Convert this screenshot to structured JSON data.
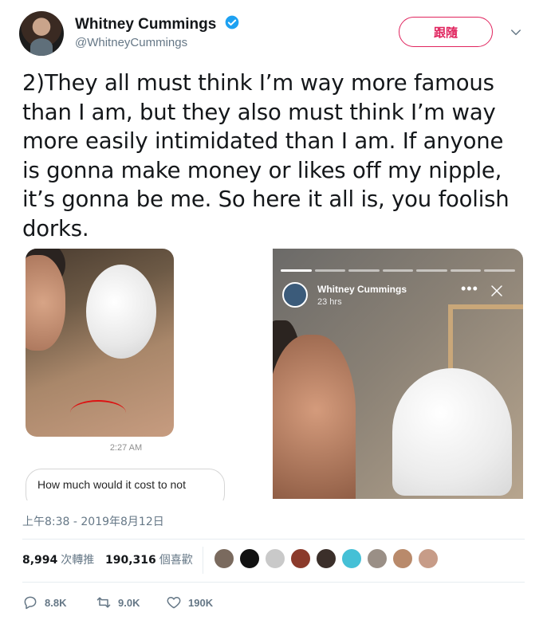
{
  "author": {
    "name": "Whitney Cummings",
    "handle": "@WhitneyCummings",
    "verified": true
  },
  "follow_button": {
    "label": "跟隨"
  },
  "tweet": {
    "lines": [
      "2)They all must think I’m way more famous",
      "than I am, but they also must think I’m way",
      "more easily intimidated than I am. If anyone",
      "is gonna make money or likes off my nipple,",
      "it’s gonna be me. So here it all is, you foolish",
      "dorks."
    ]
  },
  "media": {
    "left": {
      "message_time": "2:27 AM",
      "message_text": "How much would it cost to not"
    },
    "right": {
      "story_user": "Whitney Cummings",
      "story_time": "23 hrs",
      "story_progress_segments": 7,
      "story_current_segment": 1
    }
  },
  "timestamp": "上午8:38 - 2019年8月12日",
  "stats": {
    "retweets_count": "8,994",
    "retweets_label": "次轉推",
    "likes_count": "190,316",
    "likes_label": "個喜歡",
    "liker_avatar_colors": [
      "#7a6a5e",
      "#111111",
      "#c9c9c9",
      "#8b3a2b",
      "#3b2f2a",
      "#45c0d6",
      "#9a8f86",
      "#b98a6b",
      "#c79c88"
    ]
  },
  "actions": {
    "reply_count": "8.8K",
    "retweet_count": "9.0K",
    "like_count": "190K"
  },
  "colors": {
    "accent": "#e0245e",
    "verified": "#1da1f2",
    "muted": "#657786",
    "text": "#14171a"
  },
  "icons": {
    "verified": "verified-badge-icon",
    "menu": "chevron-down-icon",
    "reply": "reply-icon",
    "retweet": "retweet-icon",
    "like": "heart-icon",
    "story_more": "more-dots-icon",
    "story_close": "close-icon"
  }
}
